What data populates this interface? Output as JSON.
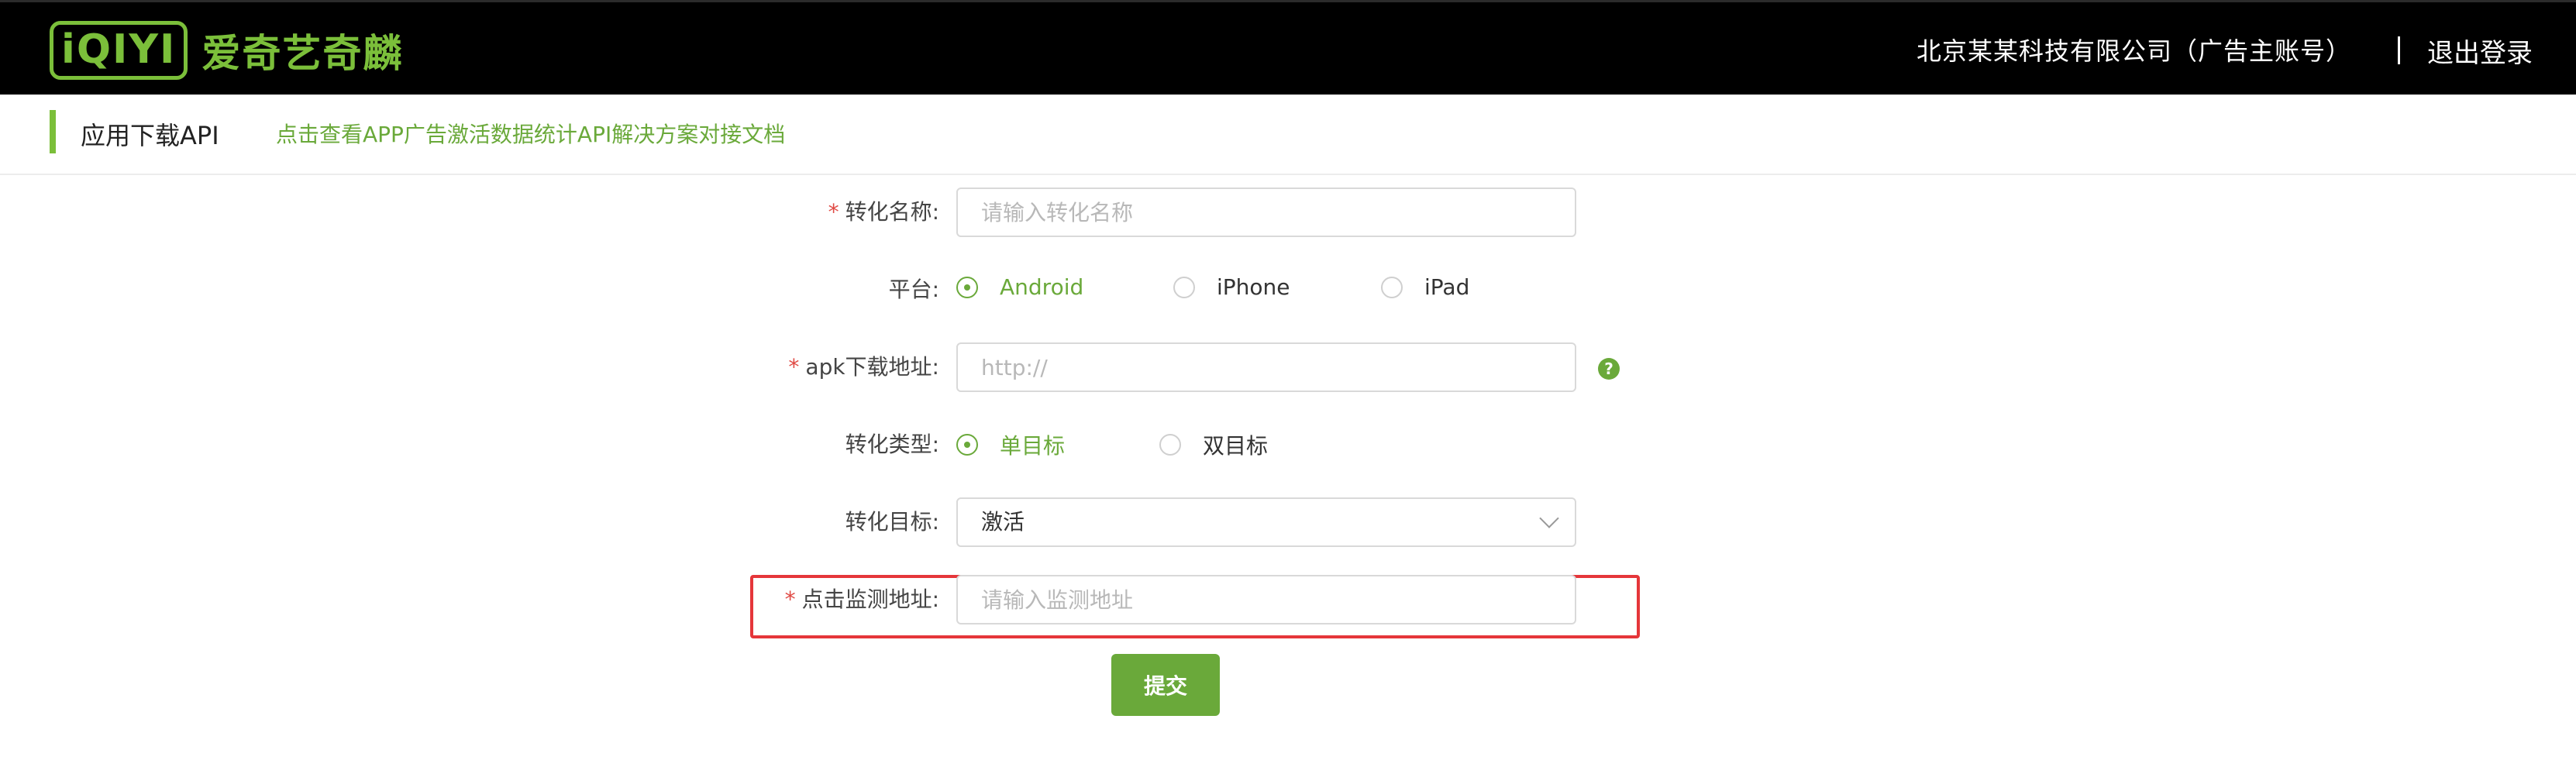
{
  "header": {
    "logo_mark": "iQIYI",
    "logo_text": "爱奇艺奇麟",
    "account_name": "北京某某科技有限公司（广告主账号）",
    "logout_label": "退出登录"
  },
  "subheader": {
    "title": "应用下载API",
    "doc_link": "点击查看APP广告激活数据统计API解决方案对接文档"
  },
  "form": {
    "conversion_name": {
      "label": "转化名称:",
      "placeholder": "请输入转化名称",
      "value": ""
    },
    "platform": {
      "label": "平台:",
      "options": [
        "Android",
        "iPhone",
        "iPad"
      ],
      "selected": "Android"
    },
    "apk_url": {
      "label": "apk下载地址:",
      "placeholder": "http://",
      "value": "",
      "help_glyph": "?"
    },
    "conversion_type": {
      "label": "转化类型:",
      "options": [
        "单目标",
        "双目标"
      ],
      "selected": "单目标"
    },
    "conversion_goal": {
      "label": "转化目标:",
      "value": "激活"
    },
    "click_monitor_url": {
      "label": "点击监测地址:",
      "placeholder": "请输入监测地址",
      "value": ""
    },
    "required_mark": "*",
    "submit_label": "提交"
  },
  "colors": {
    "accent": "#6aa93a",
    "brand": "#7bbf3a",
    "required": "#e04a44",
    "highlight": "#e5363a",
    "header_bg": "#000000"
  }
}
